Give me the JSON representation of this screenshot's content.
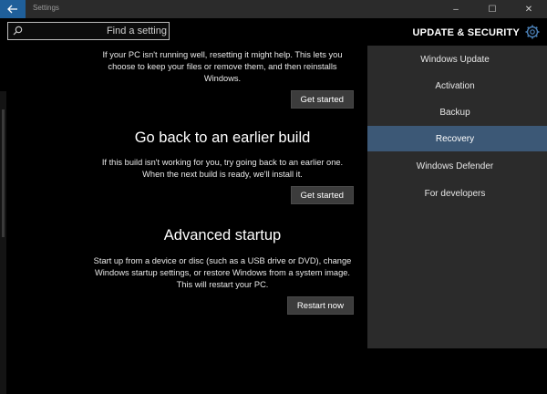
{
  "window": {
    "title": "Settings",
    "minimize": "–",
    "maximize": "☐",
    "close": "✕"
  },
  "search": {
    "placeholder": "Find a setting"
  },
  "header": {
    "section_title": "UPDATE & SECURITY"
  },
  "reset": {
    "text": "If your PC isn't running well, resetting it might help. This lets you choose to keep your files or remove them, and then reinstalls Windows.",
    "button": "Get started"
  },
  "go_back": {
    "title": "Go back to an earlier build",
    "text": "If this build isn't working for you, try going back to an earlier one. When the next build is ready, we'll install it.",
    "button": "Get started"
  },
  "advanced": {
    "title": "Advanced startup",
    "text": "Start up from a device or disc (such as a USB drive or DVD), change Windows startup settings, or restore Windows from a system image. This will restart your PC.",
    "button": "Restart now"
  },
  "nav": {
    "items": [
      {
        "label": "Windows Update"
      },
      {
        "label": "Activation"
      },
      {
        "label": "Backup"
      },
      {
        "label": "Recovery"
      },
      {
        "label": "Windows Defender"
      },
      {
        "label": "For developers"
      }
    ],
    "selected": "Recovery"
  },
  "colors": {
    "accent": "#1f5f9a",
    "selected_nav": "#3c5876",
    "nav_bg": "#2b2b2b",
    "button_bg": "#3c3c3c"
  }
}
